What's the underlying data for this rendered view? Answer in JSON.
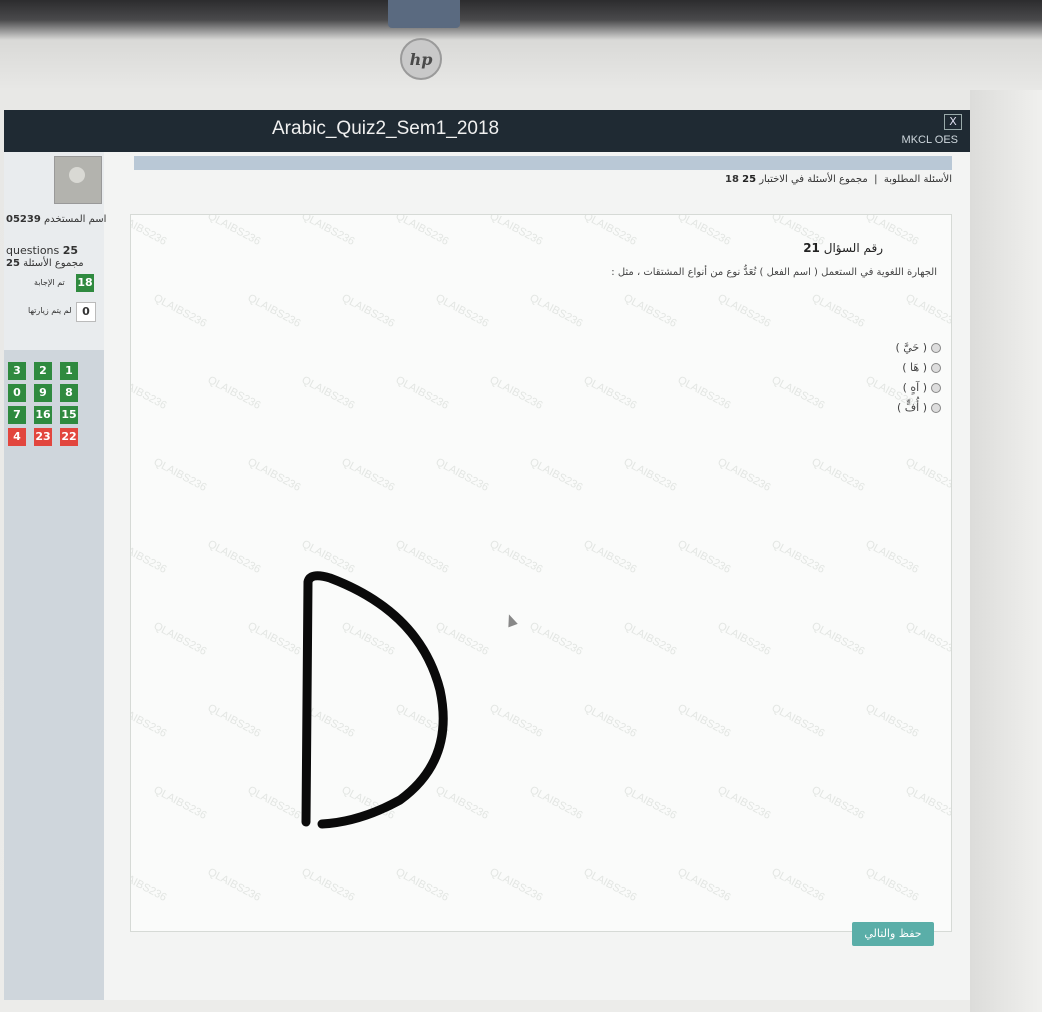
{
  "window": {
    "title": "Arabic_Quiz2_Sem1_2018",
    "brand": "MKCL OES",
    "close_label": "X"
  },
  "monitor": {
    "logo": "hp"
  },
  "left_panel": {
    "candidate_label": "اسم المستخدم",
    "candidate_id_fragment": "05239",
    "total_questions_label": "questions",
    "total_questions_value": "25",
    "total_questions_ar_label": "مجموع الأسئلة",
    "total_questions_ar_value": "25",
    "answered_label": "تم الإجابة",
    "answered_count": "18",
    "not_answered_label": "لم يتم زيارتها",
    "not_answered_count": "0",
    "question_grid": [
      [
        "3",
        "2",
        "1"
      ],
      [
        "0",
        "9",
        "8"
      ],
      [
        "7",
        "16",
        "15"
      ],
      [
        "4",
        "23",
        "22"
      ]
    ],
    "question_grid_status": [
      [
        "green",
        "green",
        "green"
      ],
      [
        "green",
        "green",
        "green"
      ],
      [
        "green",
        "green",
        "green"
      ],
      [
        "red",
        "red",
        "red"
      ]
    ]
  },
  "stats": {
    "total_label": "مجموع الأسئلة في الاختبار",
    "total_value": "25",
    "required_label": "الأسئلة المطلوبة",
    "required_value": "18"
  },
  "question": {
    "number_label": "رقم السؤال",
    "number_value": "21",
    "text": "الجهارة اللغوية في الستعمل ( اسم الفعل ) تُعَدُّ نوع من أنواع المشتقات ، مثل :",
    "options": [
      "( حَيَّ )",
      "( هَا )",
      "( آهٍ )",
      "( أُفٍّ )"
    ]
  },
  "buttons": {
    "save_next": "حفظ والتالي"
  },
  "watermark_text": "QLAIBS236"
}
